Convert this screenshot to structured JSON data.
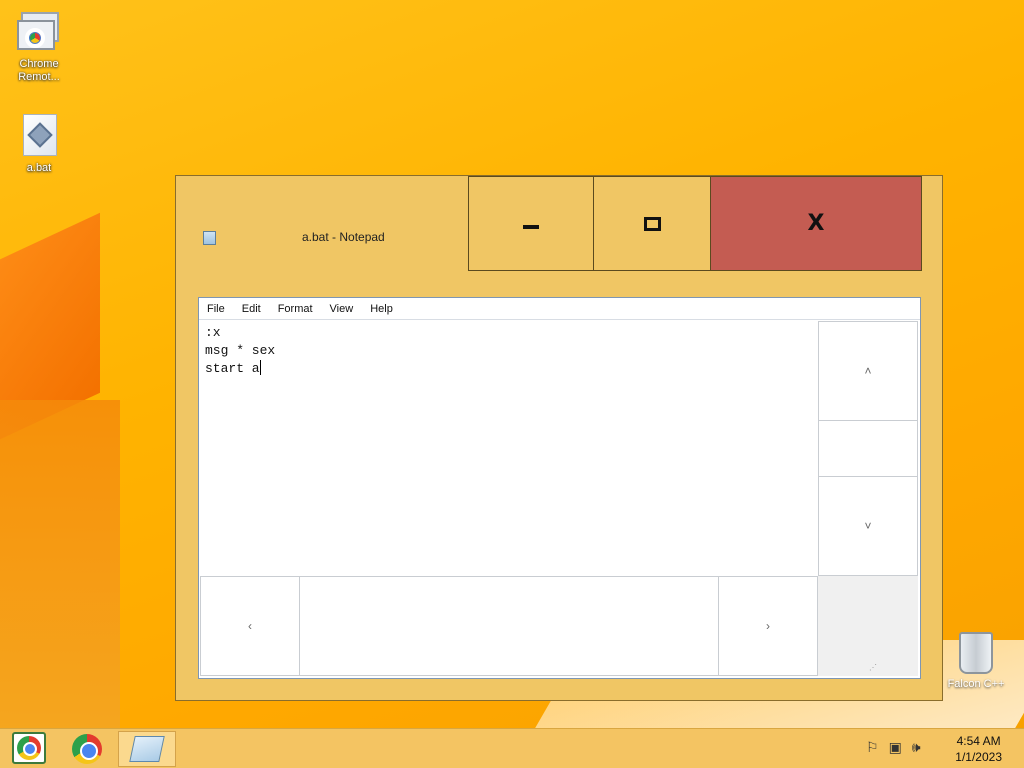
{
  "desktop": {
    "icons": [
      {
        "label": "Chrome Remot..."
      },
      {
        "label": "a.bat"
      }
    ],
    "recycle_bin_label": "Falcon C++"
  },
  "window": {
    "title": "a.bat - Notepad",
    "close_color": "#c45c52",
    "frame_color": "#f0c664",
    "menu": [
      "File",
      "Edit",
      "Format",
      "View",
      "Help"
    ],
    "content_lines": [
      ":x",
      "msg * sex",
      "start a"
    ]
  },
  "scrollbar": {
    "up_glyph": "˄",
    "down_glyph": "˅",
    "left_glyph": "‹",
    "right_glyph": "›"
  },
  "taskbar": {
    "apps": [
      "chrome-remote-desktop-icon",
      "chrome-icon",
      "notepad-icon"
    ],
    "active_app": "notepad-icon",
    "clock": {
      "time": "4:54 AM",
      "date": "1/1/2023"
    }
  }
}
